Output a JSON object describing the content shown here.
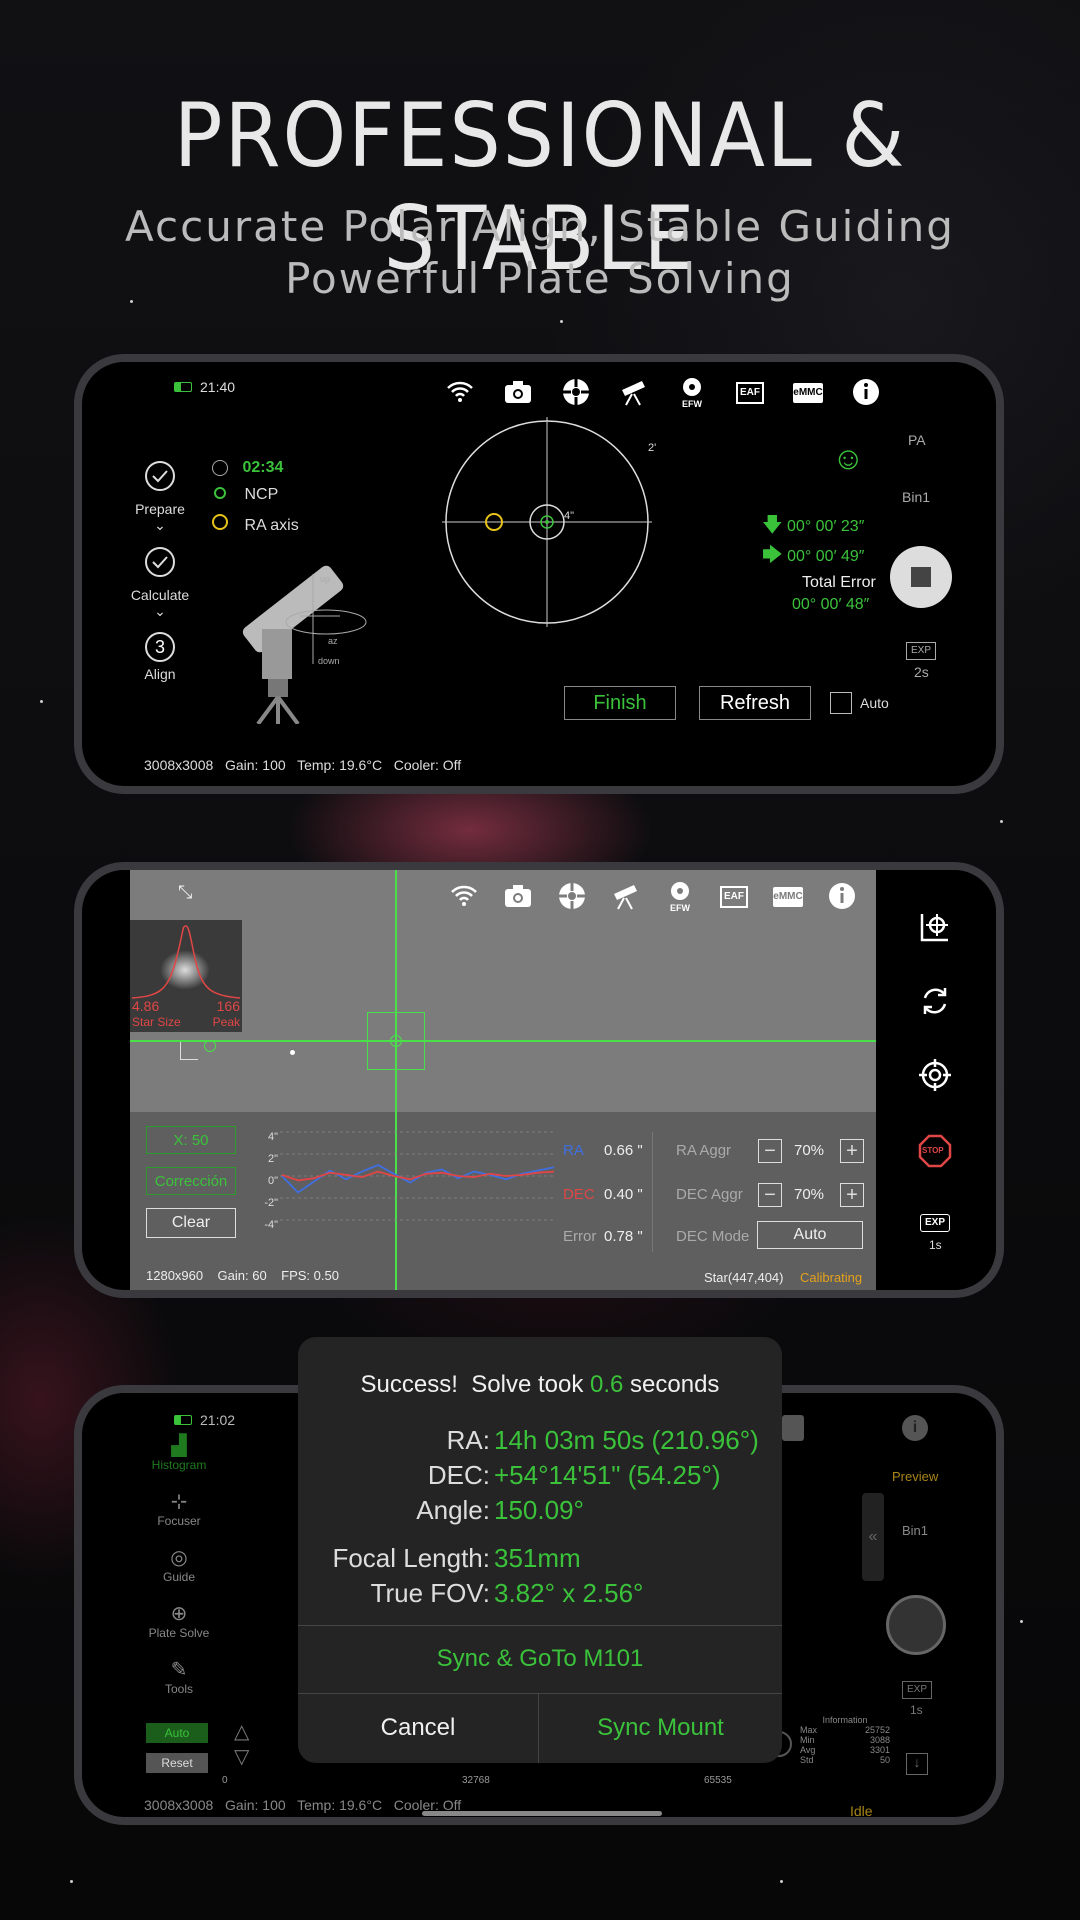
{
  "hero": {
    "title": "PROFESSIONAL & STABLE",
    "subtitle_line1": "Accurate Polar Align, Stable Guiding",
    "subtitle_line2": "Powerful Plate Solving"
  },
  "colors": {
    "accent_green": "#3bc23b",
    "dec_red": "#e04646",
    "ra_blue": "#3f6fe0",
    "calibrating_orange": "#e6a21a"
  },
  "toolbar_icons": [
    "wifi-icon",
    "camera-icon",
    "filter-wheel-icon",
    "telescope-icon",
    "efw-icon",
    "eaf-icon",
    "emmc-icon",
    "info-icon"
  ],
  "toolbar_labels": {
    "efw": "EFW",
    "eaf": "EAF",
    "emmc": "eMMC"
  },
  "screen1": {
    "time": "21:40",
    "steps": [
      {
        "label": "Prepare"
      },
      {
        "label": "Calculate"
      },
      {
        "label": "Align",
        "num": "3"
      }
    ],
    "timer": "02:34",
    "ncp": "NCP",
    "ra_axis": "RA axis",
    "scale_outer": "2'",
    "scale_inner": "4\"",
    "mount_labels": {
      "up": "up",
      "down": "down",
      "az": "az"
    },
    "pa": "PA",
    "bin": "Bin1",
    "err_down": "00° 00′ 23″",
    "err_right": "00° 00′ 49″",
    "total_label": "Total Error",
    "total_value": "00° 00′ 48″",
    "exp": "EXP",
    "exp_val": "2s",
    "finish": "Finish",
    "refresh": "Refresh",
    "auto": "Auto",
    "status": "3008x3008   Gain: 100   Temp: 19.6°C   Cooler: Off"
  },
  "screen2": {
    "star_size": "4.86",
    "star_size_label": "Star Size",
    "peak": "166",
    "peak_label": "Peak",
    "x_btn": "X: 50",
    "corr_btn": "Corrección",
    "clear_btn": "Clear",
    "y_ticks": [
      "4\"",
      "2\"",
      "0\"",
      "-2\"",
      "-4\""
    ],
    "ra": "RA",
    "ra_val": "0.66 \"",
    "dec": "DEC",
    "dec_val": "0.40 \"",
    "error": "Error",
    "error_val": "0.78 \"",
    "ra_aggr": "RA Aggr",
    "ra_aggr_val": "70%",
    "dec_aggr": "DEC Aggr",
    "dec_aggr_val": "70%",
    "dec_mode": "DEC Mode",
    "dec_mode_val": "Auto",
    "status": "1280x960    Gain: 60    FPS: 0.50",
    "star": "Star(447,404)",
    "calibrating": "Calibrating",
    "stop": "STOP",
    "exp": "EXP",
    "exp_val": "1s",
    "guide_chart": {
      "type": "line",
      "series": [
        {
          "name": "RA",
          "values": [
            0,
            -1.5,
            -0.5,
            0.5,
            -0.3,
            0.4,
            1,
            0.2,
            -0.6,
            0.3,
            0.6,
            -0.2,
            0.4,
            0.1,
            -0.3,
            0.2,
            0.5,
            0.8
          ]
        },
        {
          "name": "DEC",
          "values": [
            0.1,
            -0.4,
            -0.2,
            0.3,
            0.1,
            -0.1,
            0.4,
            0.0,
            -0.3,
            0.2,
            0.3,
            0.0,
            -0.1,
            0.2,
            0.0,
            0.1,
            0.3,
            0.4
          ]
        }
      ]
    }
  },
  "screen3": {
    "time": "21:02",
    "menu": [
      "Histogram",
      "Focuser",
      "Guide",
      "Plate Solve",
      "Tools"
    ],
    "auto": "Auto",
    "reset": "Reset",
    "hist_min": "0",
    "hist_mid": "32768",
    "hist_max": "65535",
    "info_title": "Information",
    "info": [
      [
        "Max",
        "25752"
      ],
      [
        "Min",
        "3088"
      ],
      [
        "Avg",
        "3301"
      ],
      [
        "Std",
        "50"
      ]
    ],
    "preview": "Preview",
    "bin": "Bin1",
    "exp": "EXP",
    "exp_val": "1s",
    "idle": "Idle",
    "status": "3008x3008   Gain: 100   Temp: 19.6°C   Cooler: Off"
  },
  "dialog": {
    "title_pre": "Success!  Solve took ",
    "title_num": "0.6",
    "title_post": " seconds",
    "rows": [
      {
        "label": "RA:",
        "value": "14h 03m 50s (210.96°)"
      },
      {
        "label": "DEC:",
        "value": "+54°14'51\" (54.25°)"
      },
      {
        "label": "Angle:",
        "value": "150.09°"
      },
      {
        "label": "Focal Length:",
        "value": "351mm"
      },
      {
        "label": "True FOV:",
        "value": "3.82° x 2.56°"
      }
    ],
    "sync_goto": "Sync & GoTo M101",
    "cancel": "Cancel",
    "sync_mount": "Sync Mount"
  }
}
